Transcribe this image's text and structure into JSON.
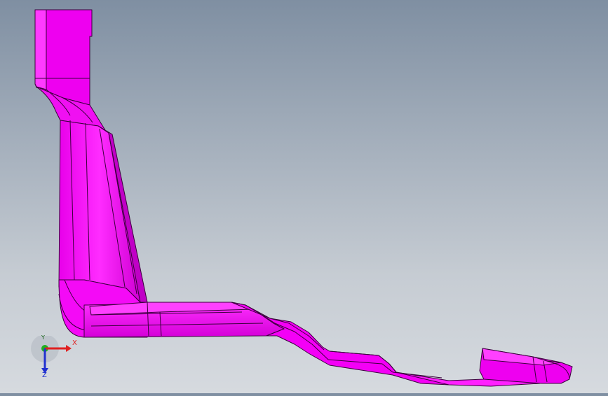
{
  "viewport": {
    "background_top": "#7f8fa2",
    "background_bottom": "#d6dadf",
    "part_color": "#ff00ff",
    "part_shade": "#c400c8",
    "edge_color": "#3a003c"
  },
  "triad": {
    "x_label": "X",
    "y_label": "Y",
    "z_label": "Z",
    "x_color": "#e02020",
    "y_color": "#20b020",
    "z_color": "#2030d0"
  }
}
